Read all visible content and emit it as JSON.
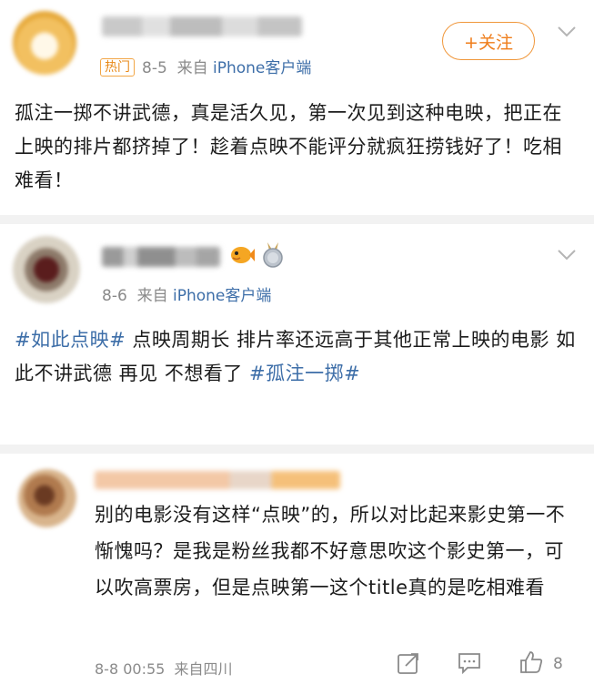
{
  "post1": {
    "badge": "热门",
    "date": "8-5",
    "source_prefix": "来自 ",
    "source": "iPhone客户端",
    "follow_label": "+关注",
    "content": "孤注一掷不讲武德，真是活久见，第一次见到这种电映，把正在上映的排片都挤掉了！趁着点映不能评分就疯狂捞钱好了！吃相难看！"
  },
  "post2": {
    "date": "8-6",
    "source_prefix": "来自 ",
    "source": "iPhone客户端",
    "tag1": "#如此点映#",
    "content": " 点映周期长 排片率还远高于其他正常上映的电影 如此不讲武德 再见 不想看了 ",
    "tag2": "#孤注一掷#"
  },
  "post3": {
    "content": "别的电影没有这样“点映”的，所以对比起来影史第一不惭愧吗？是我是粉丝我都不好意思吹这个影史第一，可以吹高票房，但是点映第一这个title真的是吃相难看",
    "footer_time": "8-8 00:55",
    "footer_location": "来自四川",
    "like_count": "8"
  },
  "colors": {
    "accent_orange": "#ef7d1a",
    "link_blue": "#3d6ea8",
    "meta_gray": "#8a8a8a"
  },
  "icons": [
    "chevron-down-icon",
    "share-icon",
    "comment-icon",
    "like-icon",
    "fish-emoji-icon",
    "medal-icon"
  ]
}
